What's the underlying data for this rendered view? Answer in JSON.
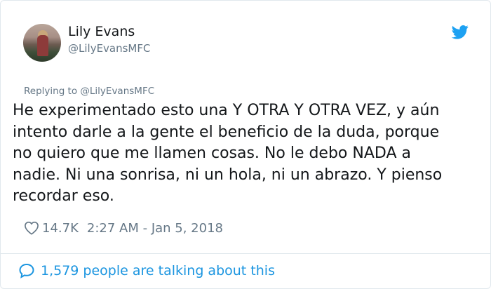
{
  "user": {
    "name": "Lily Evans",
    "handle": "@LilyEvansMFC"
  },
  "tweet": {
    "replying_to": "Replying to @LilyEvansMFC",
    "text": "He experimentado esto una Y OTRA Y OTRA VEZ, y aún\nintento darle a la gente el beneficio de la duda, porque\nno quiero que me llamen cosas. No le debo NADA  a\nnadie. Ni una sonrisa, ni un hola, ni un abrazo. Y pienso\nrecordar eso.",
    "likes": "14.7K",
    "timestamp": "2:27 AM - Jan 5, 2018"
  },
  "footer": {
    "talking": "1,579 people are talking about this"
  },
  "icons": {
    "brand": "twitter-bird-icon",
    "like": "heart-icon",
    "reply": "comment-bubble-icon"
  },
  "colors": {
    "accent": "#1da1f2",
    "link": "#1b95e0",
    "muted": "#657786",
    "text": "#14171a"
  }
}
